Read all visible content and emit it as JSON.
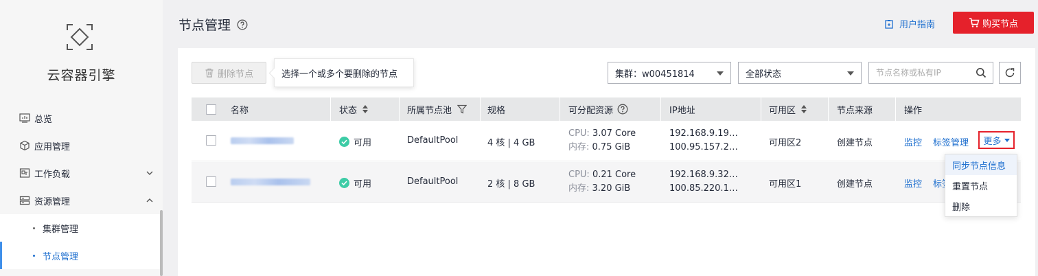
{
  "sidebar": {
    "app_name": "云容器引擎",
    "items": [
      {
        "label": "总览"
      },
      {
        "label": "应用管理"
      },
      {
        "label": "工作负载"
      },
      {
        "label": "资源管理"
      }
    ],
    "sub_items": [
      {
        "label": "集群管理"
      },
      {
        "label": "节点管理"
      }
    ]
  },
  "header": {
    "title": "节点管理",
    "guide_label": "用户指南",
    "buy_label": "购买节点"
  },
  "toolbar": {
    "delete_label": "删除节点",
    "tooltip": "选择一个或多个要删除的节点",
    "cluster_select": "集群：w00451814",
    "status_select": "全部状态",
    "search_placeholder": "节点名称或私有IP"
  },
  "table": {
    "columns": [
      "名称",
      "状态",
      "所属节点池",
      "规格",
      "可分配资源",
      "IP地址",
      "可用区",
      "节点来源",
      "操作"
    ],
    "rows": [
      {
        "status": "可用",
        "pool": "DefaultPool",
        "spec": "4 核 | 4 GB",
        "cpu_label": "CPU:",
        "cpu_value": "3.07 Core",
        "mem_label": "内存:",
        "mem_value": "0.75 GiB",
        "ip1": "192.168.9.19…",
        "ip2": "100.95.157.2…",
        "zone": "可用区2",
        "source": "创建节点",
        "action_monitor": "监控",
        "action_tags": "标签管理",
        "action_more": "更多"
      },
      {
        "status": "可用",
        "pool": "DefaultPool",
        "spec": "2 核 | 8 GB",
        "cpu_label": "CPU:",
        "cpu_value": "0.21 Core",
        "mem_label": "内存:",
        "mem_value": "3.20 GiB",
        "ip1": "192.168.9.32…",
        "ip2": "100.85.220.1…",
        "zone": "可用区1",
        "source": "创建节点",
        "action_monitor": "监控",
        "action_tags": "标签"
      }
    ]
  },
  "more_menu": {
    "items": [
      "同步节点信息",
      "重置节点",
      "删除"
    ]
  },
  "colors": {
    "accent": "#1e6fcf",
    "brand_red": "#e5212b",
    "success": "#3dcca6"
  }
}
